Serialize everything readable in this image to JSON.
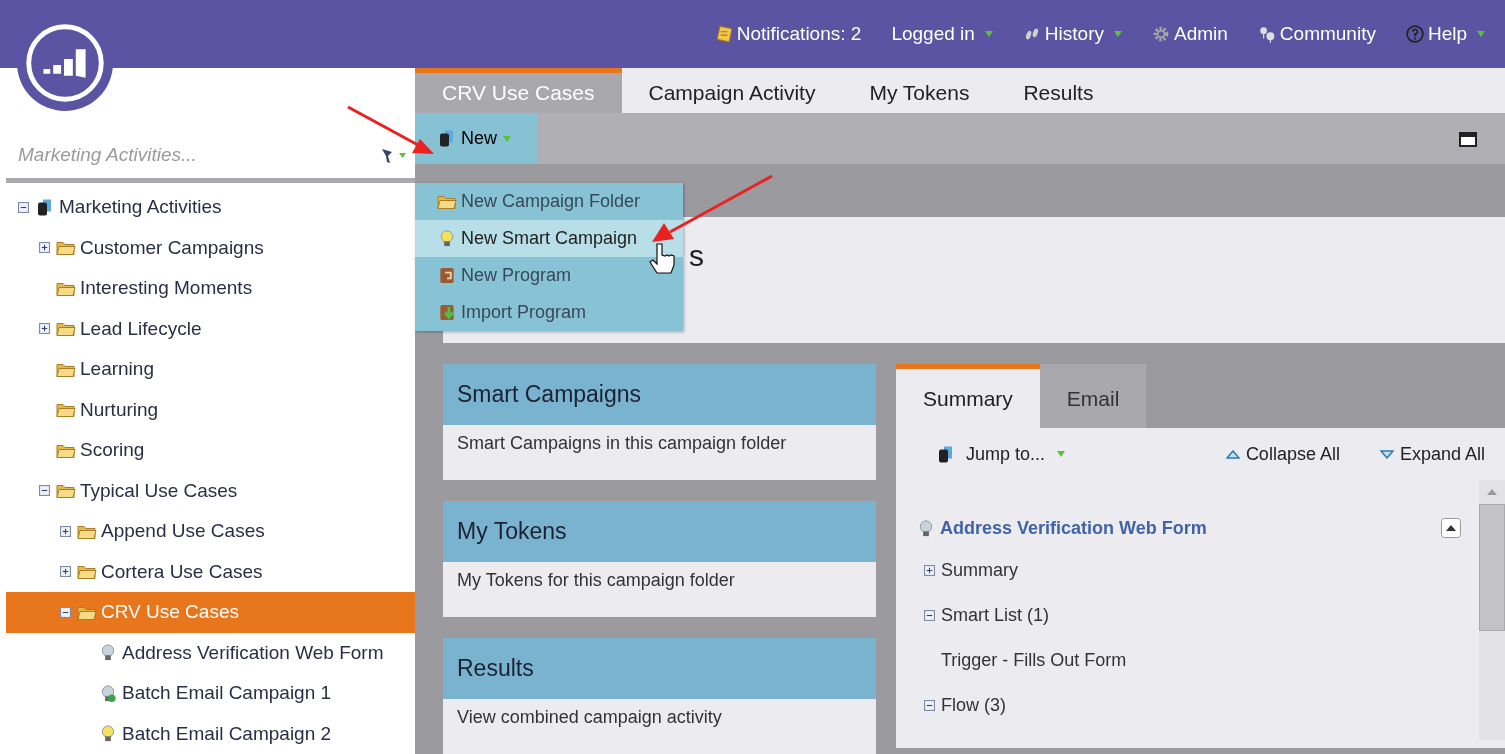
{
  "header": {
    "nav": [
      {
        "label": "Notifications: 2",
        "kind": "notes",
        "caret": false
      },
      {
        "label": "Logged in",
        "kind": "plain",
        "caret": true
      },
      {
        "label": "History",
        "kind": "steps",
        "caret": true
      },
      {
        "label": "Admin",
        "kind": "gear",
        "caret": false
      },
      {
        "label": "Community",
        "kind": "pins",
        "caret": false
      },
      {
        "label": "Help",
        "kind": "help",
        "caret": true
      }
    ]
  },
  "sidebar": {
    "search": {
      "placeholder": "Marketing Activities..."
    },
    "tree": [
      {
        "label": "Marketing Activities",
        "kind": "program",
        "expanded": true,
        "selected": false,
        "children": [
          {
            "label": "Customer Campaigns",
            "kind": "folder",
            "expanded": false,
            "selected": false
          },
          {
            "label": "Interesting Moments",
            "kind": "folder",
            "selected": false
          },
          {
            "label": "Lead Lifecycle",
            "kind": "folder",
            "expanded": false,
            "selected": false
          },
          {
            "label": "Learning",
            "kind": "folder",
            "selected": false
          },
          {
            "label": "Nurturing",
            "kind": "folder",
            "selected": false
          },
          {
            "label": "Scoring",
            "kind": "folder",
            "selected": false
          },
          {
            "label": "Typical Use Cases",
            "kind": "folder",
            "expanded": true,
            "selected": false,
            "children": [
              {
                "label": "Append Use Cases",
                "kind": "folder",
                "expanded": false,
                "selected": false
              },
              {
                "label": "Cortera Use Cases",
                "kind": "folder",
                "expanded": false,
                "selected": false
              },
              {
                "label": "CRV Use Cases",
                "kind": "folder",
                "expanded": true,
                "selected": true,
                "children": [
                  {
                    "label": "Address Verification Web Form",
                    "kind": "idle",
                    "selected": false
                  },
                  {
                    "label": "Batch Email Campaign 1",
                    "kind": "running",
                    "selected": false
                  },
                  {
                    "label": "Batch Email Campaign 2",
                    "kind": "active",
                    "selected": false
                  }
                ]
              }
            ]
          }
        ]
      }
    ]
  },
  "tabs": [
    {
      "label": "CRV Use Cases",
      "selected": true
    },
    {
      "label": "Campaign Activity",
      "selected": false
    },
    {
      "label": "My Tokens",
      "selected": false
    },
    {
      "label": "Results",
      "selected": false
    }
  ],
  "toolbar": {
    "new_button": "New"
  },
  "new_menu": [
    {
      "label": "New Campaign Folder",
      "kind": "folder",
      "selected": false
    },
    {
      "label": "New Smart Campaign",
      "kind": "campaign",
      "selected": true
    },
    {
      "label": "New Program",
      "kind": "program",
      "selected": false
    },
    {
      "label": "Import Program",
      "kind": "import",
      "selected": false
    }
  ],
  "page_title": "s",
  "cards": [
    {
      "title": "Smart Campaigns",
      "text": "Smart Campaigns in this campaign folder"
    },
    {
      "title": "My Tokens",
      "text": "My Tokens for this campaign folder"
    },
    {
      "title": "Results",
      "text": "View combined campaign activity"
    }
  ],
  "detail": {
    "tabs": [
      {
        "label": "Summary",
        "selected": true
      },
      {
        "label": "Email",
        "selected": false
      }
    ],
    "jump": "Jump to...",
    "collapse_all": "Collapse All",
    "expand_all": "Expand All",
    "campaign": "Address Verification Web Form",
    "rows": [
      {
        "label": "Summary",
        "expanded": false
      },
      {
        "label": "Smart List (1)",
        "expanded": true
      },
      {
        "label": "Trigger - Fills Out Form"
      },
      {
        "label": "Flow (3)",
        "expanded": true
      }
    ]
  }
}
